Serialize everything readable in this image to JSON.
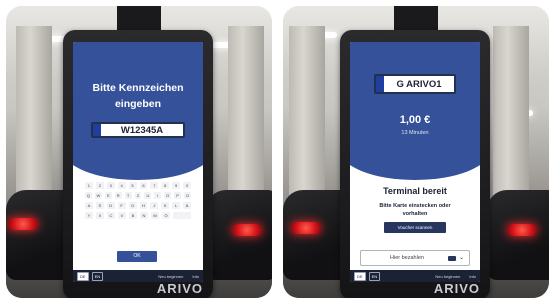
{
  "left_panel": {
    "screen": {
      "title_line1": "Bitte Kennzeichen",
      "title_line2": "eingeben",
      "plate": "W12345A",
      "keyboard": {
        "row1": [
          "1",
          "2",
          "3",
          "4",
          "5",
          "6",
          "7",
          "8",
          "9",
          "0"
        ],
        "row2": [
          "Q",
          "W",
          "E",
          "R",
          "T",
          "Z",
          "U",
          "I",
          "O",
          "P",
          "Ü"
        ],
        "row3": [
          "A",
          "S",
          "D",
          "F",
          "G",
          "H",
          "J",
          "K",
          "L",
          "Ä"
        ],
        "row4": [
          "Y",
          "X",
          "C",
          "V",
          "B",
          "N",
          "M",
          "Ö"
        ]
      },
      "ok_label": "OK",
      "bottom_bar": {
        "languages": [
          "DE",
          "EN"
        ],
        "link1": "Neu beginnen",
        "link2": "Info"
      }
    },
    "brand": "ARIVO"
  },
  "right_panel": {
    "screen": {
      "plate": "G ARIVO1",
      "price": "1,00 €",
      "duration": "13 Minuten",
      "status_title": "Terminal bereit",
      "status_sub_line1": "Bitte Karte einstecken oder",
      "status_sub_line2": "vorhalten",
      "voucher_label": "Voucher scannen",
      "pay_label": "Hier bezahlen",
      "bottom_bar": {
        "languages": [
          "DE",
          "EN"
        ],
        "link1": "Neu beginnen",
        "link2": "Info"
      }
    },
    "brand": "ARIVO"
  },
  "colors": {
    "screen_blue": "#355199",
    "bar_dark": "#1c2235",
    "taillight_red": "#d3121a"
  }
}
